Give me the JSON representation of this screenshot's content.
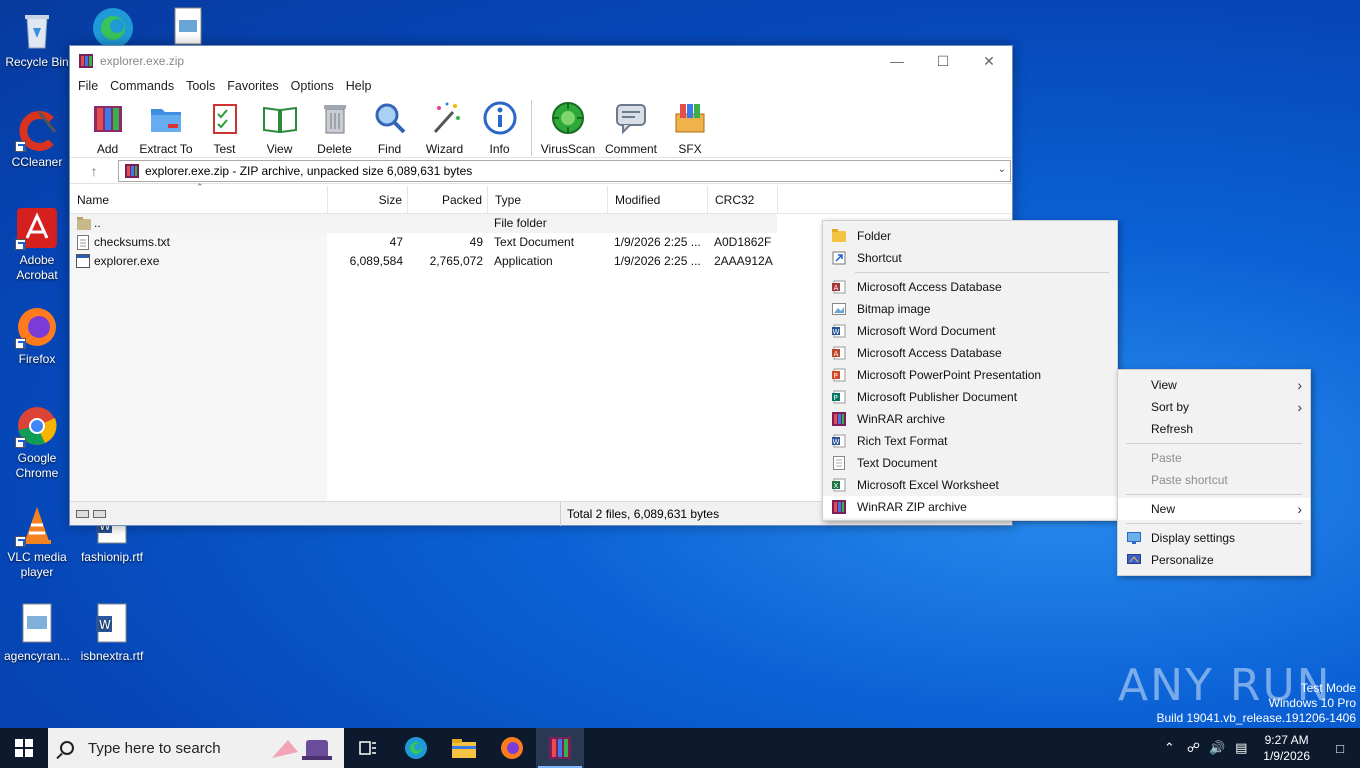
{
  "desktop": {
    "icons": [
      {
        "label": "Recycle Bin"
      },
      {
        "label": "CCleaner"
      },
      {
        "label": "Adobe Acrobat"
      },
      {
        "label": "Firefox"
      },
      {
        "label": "Google Chrome"
      },
      {
        "label": "VLC media player"
      },
      {
        "label": "agencyran..."
      },
      {
        "label": "fashionip.rtf"
      },
      {
        "label": "isbnextra.rtf"
      }
    ]
  },
  "window": {
    "title": "explorer.exe.zip",
    "menu": [
      "File",
      "Commands",
      "Tools",
      "Favorites",
      "Options",
      "Help"
    ],
    "toolbar": [
      "Add",
      "Extract To",
      "Test",
      "View",
      "Delete",
      "Find",
      "Wizard",
      "Info",
      "VirusScan",
      "Comment",
      "SFX"
    ],
    "address": "explorer.exe.zip - ZIP archive, unpacked size 6,089,631 bytes",
    "columns": [
      "Name",
      "Size",
      "Packed",
      "Type",
      "Modified",
      "CRC32"
    ],
    "rows": [
      {
        "name": "..",
        "size": "",
        "packed": "",
        "type": "File folder",
        "modified": "",
        "crc": ""
      },
      {
        "name": "checksums.txt",
        "size": "47",
        "packed": "49",
        "type": "Text Document",
        "modified": "1/9/2026 2:25 ...",
        "crc": "A0D1862F"
      },
      {
        "name": "explorer.exe",
        "size": "6,089,584",
        "packed": "2,765,072",
        "type": "Application",
        "modified": "1/9/2026 2:25 ...",
        "crc": "2AAA912A"
      }
    ],
    "status": "Total 2 files, 6,089,631 bytes"
  },
  "context_menu": {
    "items": [
      "View",
      "Sort by",
      "Refresh",
      "Paste",
      "Paste shortcut",
      "New",
      "Display settings",
      "Personalize"
    ]
  },
  "new_submenu": {
    "items": [
      "Folder",
      "Shortcut",
      "Microsoft Access Database",
      "Bitmap image",
      "Microsoft Word Document",
      "Microsoft Access Database",
      "Microsoft PowerPoint Presentation",
      "Microsoft Publisher Document",
      "WinRAR archive",
      "Rich Text Format",
      "Text Document",
      "Microsoft Excel Worksheet",
      "WinRAR ZIP archive"
    ]
  },
  "taskbar": {
    "search_placeholder": "Type here to search",
    "time": "9:27 AM",
    "date": "1/9/2026"
  },
  "watermark": {
    "line1": "Test Mode",
    "line2": "Windows 10 Pro",
    "line3": "Build 19041.vb_release.191206-1406",
    "brand": "ANY RUN"
  }
}
